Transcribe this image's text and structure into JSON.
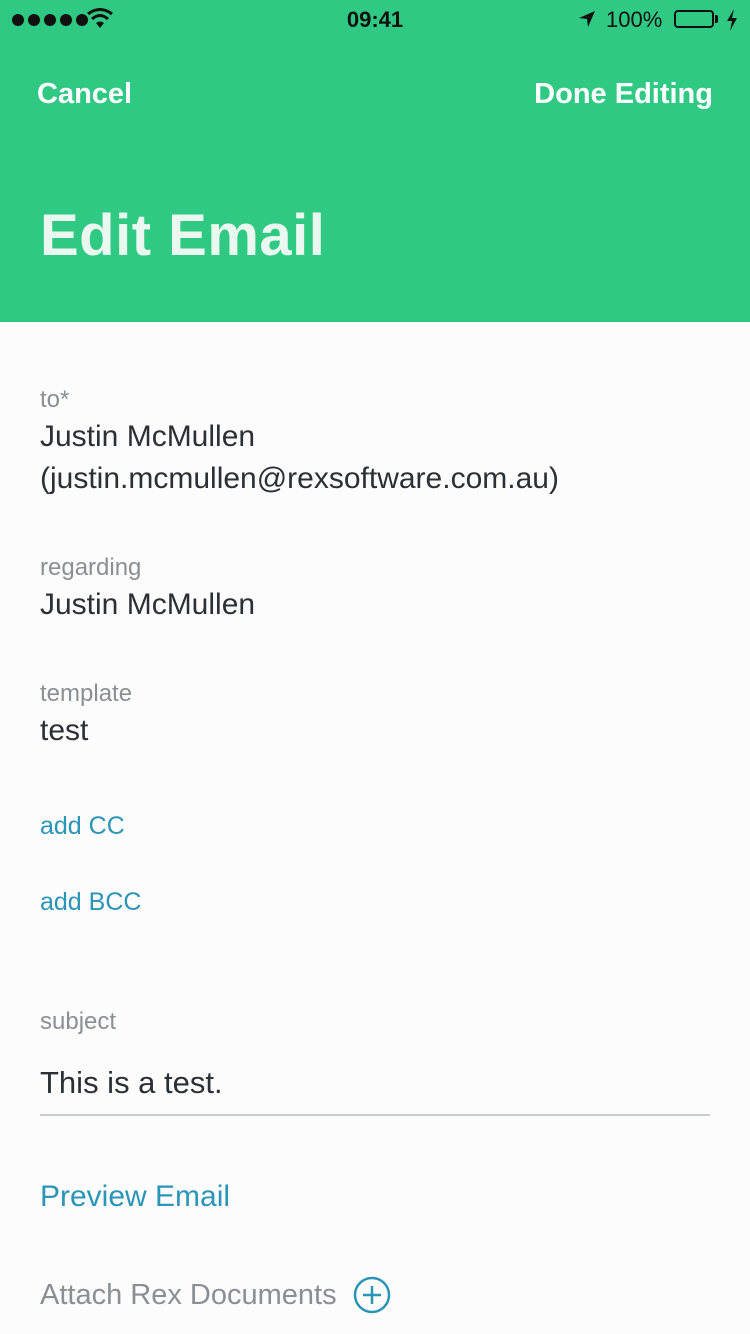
{
  "status_bar": {
    "time": "09:41",
    "battery": "100%",
    "icons": [
      "signal-dots-icon",
      "wifi-icon",
      "location-arrow-icon",
      "battery-icon",
      "charging-bolt-icon"
    ]
  },
  "nav": {
    "cancel_label": "Cancel",
    "done_label": "Done Editing",
    "title": "Edit Email"
  },
  "form": {
    "to": {
      "label": "to*",
      "value_line1": "Justin McMullen",
      "value_line2": "(justin.mcmullen@rexsoftware.com.au)"
    },
    "regarding": {
      "label": "regarding",
      "value": "Justin McMullen"
    },
    "template": {
      "label": "template",
      "value": "test"
    },
    "add_cc": "add CC",
    "add_bcc": "add BCC",
    "subject": {
      "label": "subject",
      "value": "This is a test."
    },
    "preview_label": "Preview Email",
    "attach_label": "Attach Rex Documents"
  },
  "colors": {
    "header": "#30c984",
    "link": "#2a95b7",
    "label": "#8a8f95"
  }
}
